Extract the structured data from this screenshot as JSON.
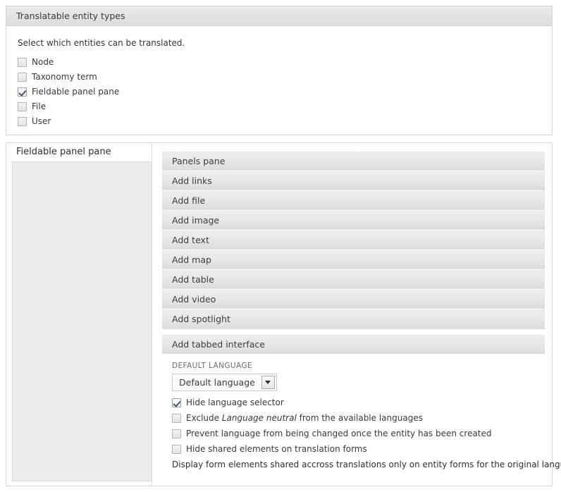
{
  "entity_types_panel": {
    "header": "Translatable entity types",
    "intro": "Select which entities can be translated.",
    "checkboxes": [
      {
        "label": "Node",
        "checked": false
      },
      {
        "label": "Taxonomy term",
        "checked": false
      },
      {
        "label": "Fieldable panel pane",
        "checked": true
      },
      {
        "label": "File",
        "checked": false
      },
      {
        "label": "User",
        "checked": false
      }
    ]
  },
  "fieldable_panel": {
    "tab_label": "Fieldable panel pane",
    "bundle_rows": [
      "Panels pane",
      "Add links",
      "Add file",
      "Add image",
      "Add text",
      "Add map",
      "Add table",
      "Add video",
      "Add spotlight"
    ],
    "tabbed_interface_row": "Add tabbed interface",
    "settings": {
      "default_language_label": "DEFAULT LANGUAGE",
      "default_language_value": "Default language",
      "options": [
        {
          "label_parts": [
            {
              "text": "Hide language selector",
              "italic": false
            }
          ],
          "checked": true
        },
        {
          "label_parts": [
            {
              "text": "Exclude ",
              "italic": false
            },
            {
              "text": "Language neutral",
              "italic": true
            },
            {
              "text": " from the available languages",
              "italic": false
            }
          ],
          "checked": false
        },
        {
          "label_parts": [
            {
              "text": "Prevent language from being changed once the entity has been created",
              "italic": false
            }
          ],
          "checked": false
        },
        {
          "label_parts": [
            {
              "text": "Hide shared elements on translation forms",
              "italic": false
            }
          ],
          "checked": false
        }
      ],
      "description": "Display form elements shared accross translations only on entity forms for the original language."
    }
  }
}
